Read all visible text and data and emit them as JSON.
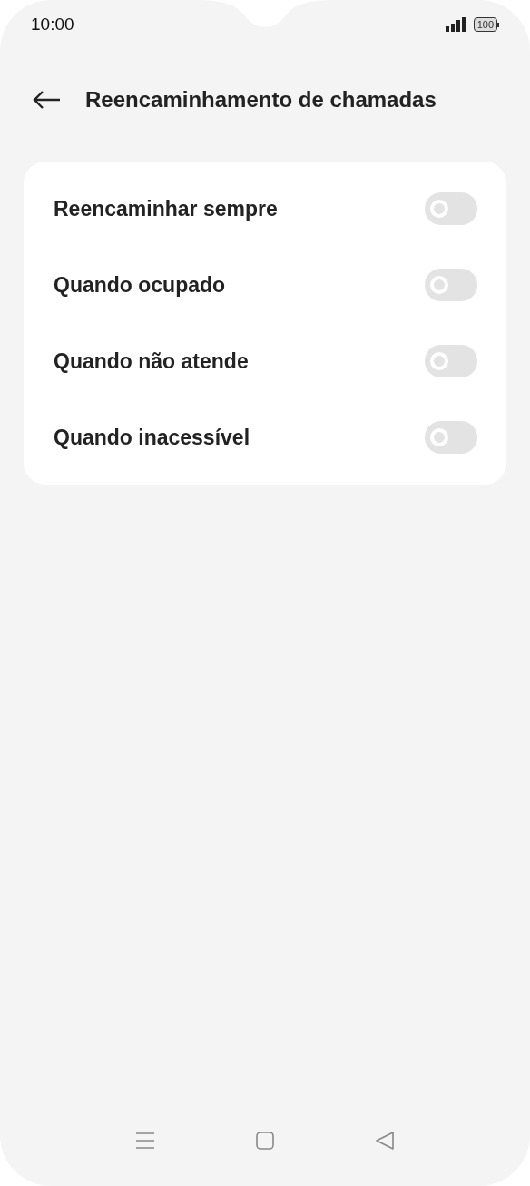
{
  "status_bar": {
    "time": "10:00",
    "battery": "100"
  },
  "header": {
    "title": "Reencaminhamento de chamadas"
  },
  "settings": [
    {
      "label": "Reencaminhar sempre",
      "on": false
    },
    {
      "label": "Quando ocupado",
      "on": false
    },
    {
      "label": "Quando não atende",
      "on": false
    },
    {
      "label": "Quando inacessível",
      "on": false
    }
  ]
}
